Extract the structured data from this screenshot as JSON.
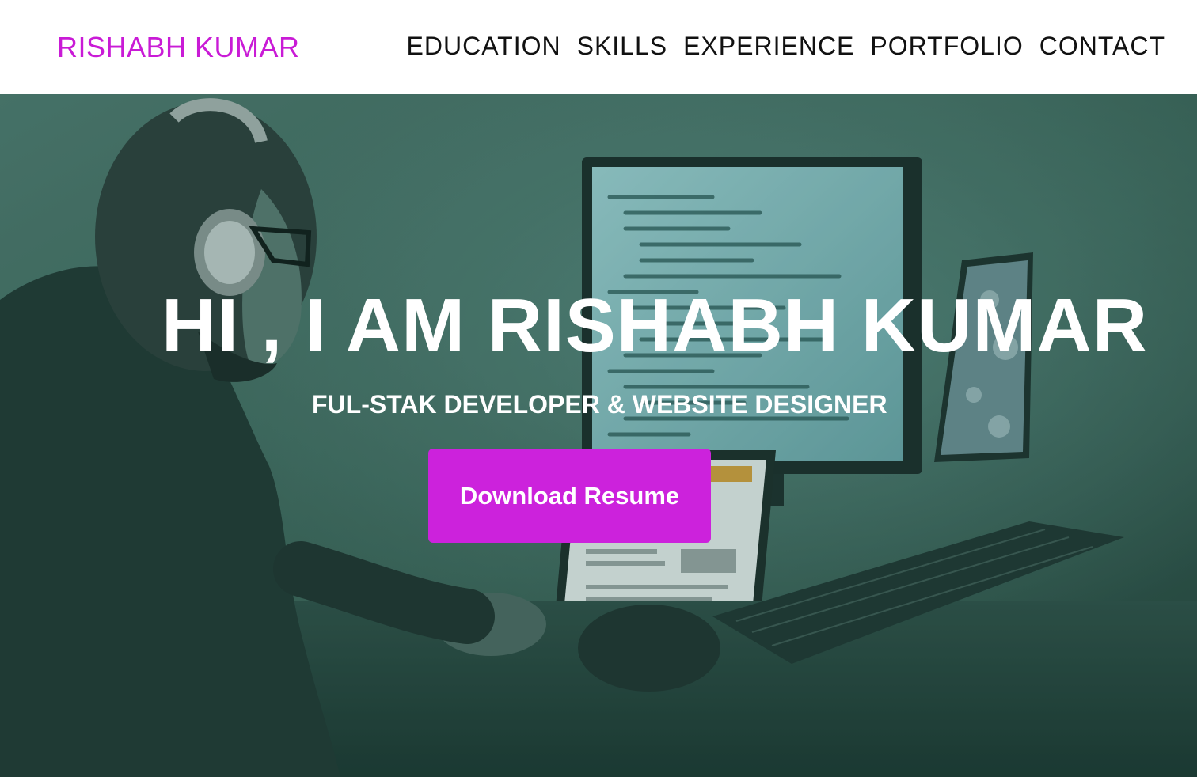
{
  "header": {
    "brand": "RISHABH KUMAR",
    "nav": [
      {
        "label": "EDUCATION"
      },
      {
        "label": "SKILLS"
      },
      {
        "label": "EXPERIENCE"
      },
      {
        "label": "PORTFOLIO"
      },
      {
        "label": "CONTACT"
      }
    ]
  },
  "hero": {
    "title": "HI , I AM RISHABH KUMAR",
    "subtitle": "FUL-STAK DEVELOPER & WEBSITE DESIGNER",
    "cta_label": "Download Resume"
  },
  "colors": {
    "brand": "#c91bd6",
    "cta": "#cc22dc",
    "hero_tint": "#2b4d45",
    "nav_text": "#111111"
  }
}
